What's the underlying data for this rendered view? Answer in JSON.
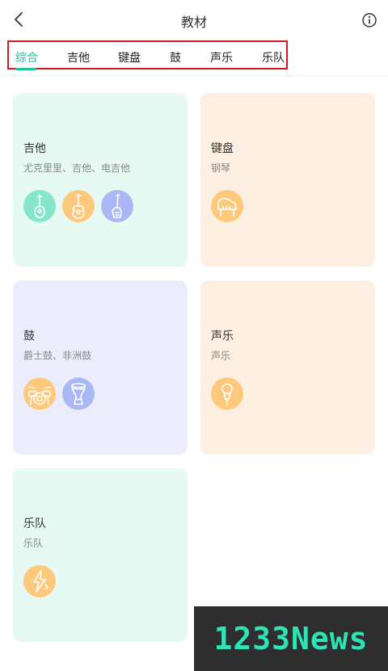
{
  "header": {
    "title": "教材",
    "back_icon": "chevron-left-icon",
    "info_icon": "info-circle-icon"
  },
  "tabs": [
    {
      "label": "综合",
      "active": true
    },
    {
      "label": "吉他",
      "active": false
    },
    {
      "label": "键盘",
      "active": false
    },
    {
      "label": "鼓",
      "active": false
    },
    {
      "label": "声乐",
      "active": false
    },
    {
      "label": "乐队",
      "active": false
    }
  ],
  "colors": {
    "accent": "#22c1a0",
    "highlight_border": "#e0141c"
  },
  "cards": [
    {
      "title": "吉他",
      "subtitle": "尤克里里、吉他、电吉他",
      "background": "#e6faf3",
      "icons": [
        {
          "name": "ukulele-icon",
          "color": "#86e6cc"
        },
        {
          "name": "guitar-icon",
          "color": "#ffc97d"
        },
        {
          "name": "electric-guitar-icon",
          "color": "#aab9f5"
        }
      ]
    },
    {
      "title": "键盘",
      "subtitle": "钢琴",
      "background": "#fdf0e2",
      "icons": [
        {
          "name": "piano-icon",
          "color": "#ffc97d"
        }
      ]
    },
    {
      "title": "鼓",
      "subtitle": "爵士鼓、非洲鼓",
      "background": "#ebedfc",
      "icons": [
        {
          "name": "drum-kit-icon",
          "color": "#ffc97d"
        },
        {
          "name": "djembe-icon",
          "color": "#aab9f5"
        }
      ]
    },
    {
      "title": "声乐",
      "subtitle": "声乐",
      "background": "#fdf0e2",
      "icons": [
        {
          "name": "microphone-icon",
          "color": "#ffc97d"
        }
      ]
    },
    {
      "title": "乐队",
      "subtitle": "乐队",
      "background": "#e6faf3",
      "icons": [
        {
          "name": "lightning-icon",
          "color": "#ffc97d"
        }
      ]
    }
  ],
  "watermark": {
    "text": "1233News"
  }
}
